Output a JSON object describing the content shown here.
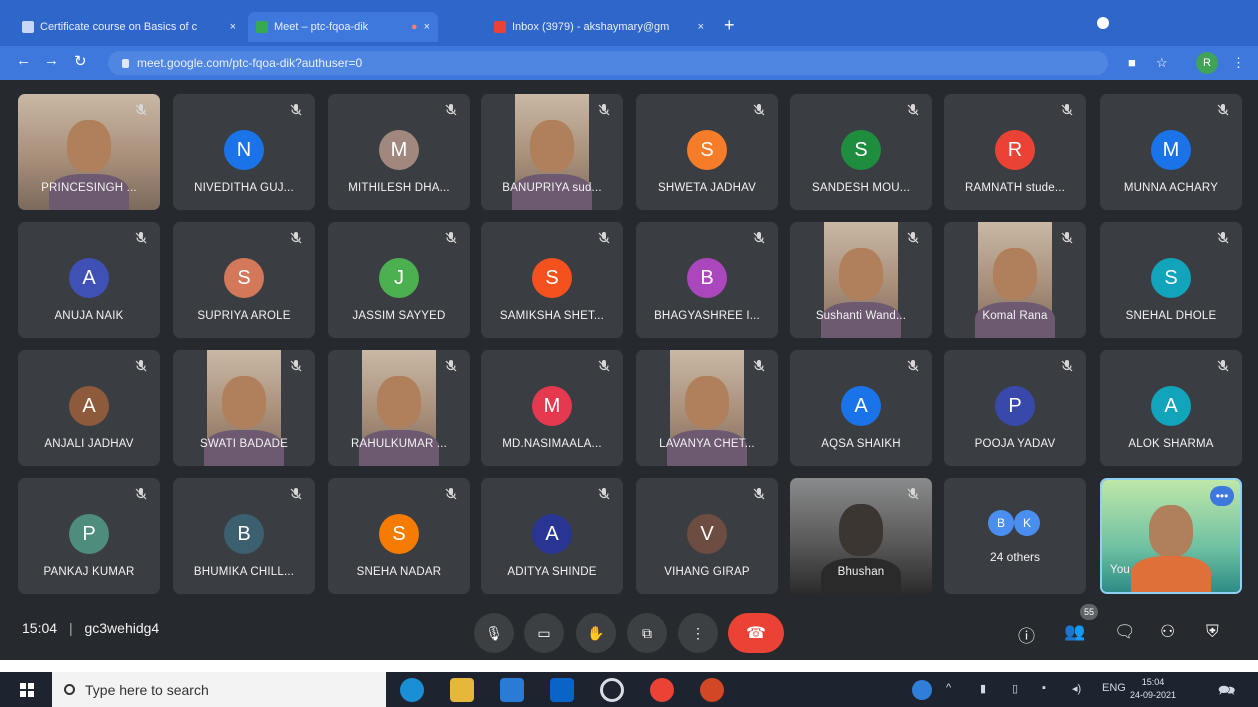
{
  "browser": {
    "tabs": [
      {
        "title": "Certificate course on Basics of c",
        "close": "×"
      },
      {
        "title": "Meet – ptc-fqoa-dik",
        "close": "×"
      },
      {
        "title": "",
        "close": "×"
      },
      {
        "title": "Inbox (3979) - akshaymary@gm",
        "close": "×"
      }
    ],
    "new_tab": "+",
    "url": "meet.google.com/ptc-fqoa-dik?authuser=0",
    "profile_initial": "R"
  },
  "participants": [
    {
      "name": "PRINCESINGH ...",
      "initial": "",
      "color": "",
      "video": true
    },
    {
      "name": "NIVEDITHA GUJ...",
      "initial": "N",
      "color": "#1a73e8",
      "video": false
    },
    {
      "name": "MITHILESH DHA...",
      "initial": "M",
      "color": "#a1887f",
      "video": false
    },
    {
      "name": "BANUPRIYA sud...",
      "initial": "",
      "color": "",
      "video": true
    },
    {
      "name": "SHWETA JADHAV",
      "initial": "S",
      "color": "#f57c28",
      "video": false
    },
    {
      "name": "SANDESH MOU...",
      "initial": "S",
      "color": "#1e8e3e",
      "video": false
    },
    {
      "name": "RAMNATH stude...",
      "initial": "R",
      "color": "#ea4335",
      "video": false
    },
    {
      "name": "MUNNA ACHARY",
      "initial": "M",
      "color": "#1a73e8",
      "video": false
    },
    {
      "name": "ANUJA NAIK",
      "initial": "A",
      "color": "#3f51b5",
      "video": false
    },
    {
      "name": "SUPRIYA AROLE",
      "initial": "S",
      "color": "#d4785a",
      "video": false
    },
    {
      "name": "JASSIM SAYYED",
      "initial": "J",
      "color": "#4caf50",
      "video": false
    },
    {
      "name": "SAMIKSHA SHET...",
      "initial": "S",
      "color": "#f4511e",
      "video": false
    },
    {
      "name": "BHAGYASHREE I...",
      "initial": "B",
      "color": "#ab47bc",
      "video": false
    },
    {
      "name": "Sushanti Wand...",
      "initial": "",
      "color": "",
      "video": true
    },
    {
      "name": "Komal Rana",
      "initial": "",
      "color": "",
      "video": true
    },
    {
      "name": "SNEHAL DHOLE",
      "initial": "S",
      "color": "#12a4bb",
      "video": false
    },
    {
      "name": "ANJALI JADHAV",
      "initial": "A",
      "color": "#8d5a3c",
      "video": false
    },
    {
      "name": "SWATI BADADE",
      "initial": "",
      "color": "",
      "video": true
    },
    {
      "name": "RAHULKUMAR ...",
      "initial": "",
      "color": "",
      "video": true
    },
    {
      "name": "MD.NASIMAALA...",
      "initial": "M",
      "color": "#e53950",
      "video": false
    },
    {
      "name": "LAVANYA CHET...",
      "initial": "",
      "color": "",
      "video": true
    },
    {
      "name": "AQSA SHAIKH",
      "initial": "A",
      "color": "#1a73e8",
      "video": false
    },
    {
      "name": "POOJA YADAV",
      "initial": "P",
      "color": "#3949ab",
      "video": false
    },
    {
      "name": "ALOK SHARMA",
      "initial": "A",
      "color": "#12a4bb",
      "video": false
    },
    {
      "name": "PANKAJ KUMAR",
      "initial": "P",
      "color": "#4e8c7e",
      "video": false
    },
    {
      "name": "BHUMIKA CHILL...",
      "initial": "B",
      "color": "#3c6070",
      "video": false
    },
    {
      "name": "SNEHA NADAR",
      "initial": "S",
      "color": "#f57c00",
      "video": false
    },
    {
      "name": "ADITYA SHINDE",
      "initial": "A",
      "color": "#283593",
      "video": false
    },
    {
      "name": "VIHANG GIRAP",
      "initial": "V",
      "color": "#6d4c41",
      "video": false
    },
    {
      "name": "Bhushan",
      "initial": "",
      "color": "",
      "video": true
    }
  ],
  "others": {
    "initials": [
      "B",
      "K"
    ],
    "label": "24 others"
  },
  "self_tile": {
    "name": "You",
    "more": "•••"
  },
  "meeting": {
    "time": "15:04",
    "separator": "|",
    "code": "gc3wehidg4",
    "participant_count": "55"
  },
  "taskbar": {
    "search_placeholder": "Type here to search",
    "language": "ENG",
    "time": "15:04",
    "date": "24-09-2021"
  },
  "colors": {
    "end_call": "#ea4335",
    "meet_bg": "#26292d",
    "tile_bg": "#3a3d42",
    "chrome_blue": "#2f66c9"
  }
}
